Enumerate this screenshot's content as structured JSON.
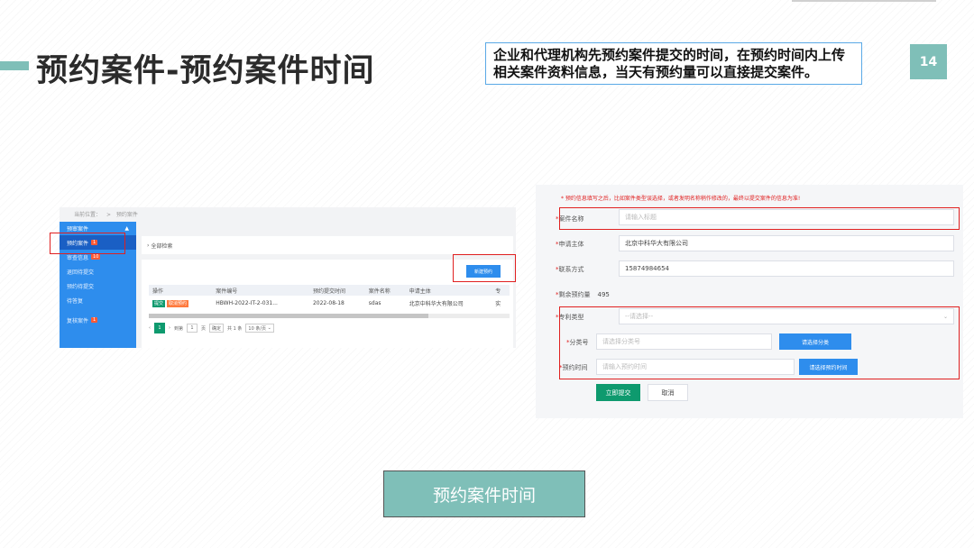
{
  "slide": {
    "title": "预约案件-预约案件时间",
    "description": "企业和代理机构先预约案件提交的时间，在预约时间内上传相关案件资料信息，当天有预约量可以直接提交案件。",
    "page_number": "14",
    "bottom_button": "预约案件时间",
    "accent_color": "#7fbfb8"
  },
  "left_screen": {
    "breadcrumb": [
      "当前位置：",
      ">",
      "预约案件"
    ],
    "sidebar": {
      "header": "预审案件",
      "header_icon": "caret-up-icon",
      "items": [
        {
          "label": "预约案件",
          "badge": "1",
          "active": true
        },
        {
          "label": "审查信息",
          "badge": "10",
          "active": false
        },
        {
          "label": "退回待提交",
          "badge": "",
          "active": false
        },
        {
          "label": "预约待提交",
          "badge": "",
          "active": false
        },
        {
          "label": "待答复",
          "badge": "",
          "active": false
        }
      ],
      "footer_item": {
        "label": "复核案件",
        "badge": "1"
      }
    },
    "search_toggle": "全部检索",
    "new_button": "新建预约",
    "table": {
      "headers": [
        "操作",
        "案件编号",
        "预约提交时间",
        "案件名称",
        "申请主体",
        "专"
      ],
      "rows": [
        {
          "actions": [
            "提交",
            "取消预约"
          ],
          "case_no": "HBWH-2022-IT-2-031...",
          "time": "2022-08-18",
          "name": "sdas",
          "applicant": "北京中科华大有限公司",
          "extra": "实"
        }
      ]
    },
    "pager": {
      "current": "1",
      "goto_label": "到第",
      "goto_value": "1",
      "page_label": "页",
      "confirm": "确定",
      "total": "共 1 条",
      "size": "10 条/页"
    }
  },
  "form": {
    "note": "* 预约信息填写之后，比如案件类型误选择，或者发明名称稍作修改的，最终以提交案件的信息为准!",
    "case_name": {
      "label": "案件名称",
      "placeholder": "请输入标题"
    },
    "applicant": {
      "label": "申请主体",
      "value": "北京中科华大有限公司"
    },
    "contact": {
      "label": "联系方式",
      "value": "15874984654"
    },
    "remaining": {
      "label": "剩余预约量",
      "value": "495"
    },
    "patent_type": {
      "label": "专利类型",
      "placeholder": "--请选择--"
    },
    "category": {
      "label": "分类号",
      "placeholder": "请选择分类号",
      "button": "请选择分类"
    },
    "time": {
      "label": "预约时间",
      "placeholder": "请输入预约时间",
      "button": "请选择预约时间"
    },
    "submit": "立即提交",
    "cancel": "取消"
  }
}
